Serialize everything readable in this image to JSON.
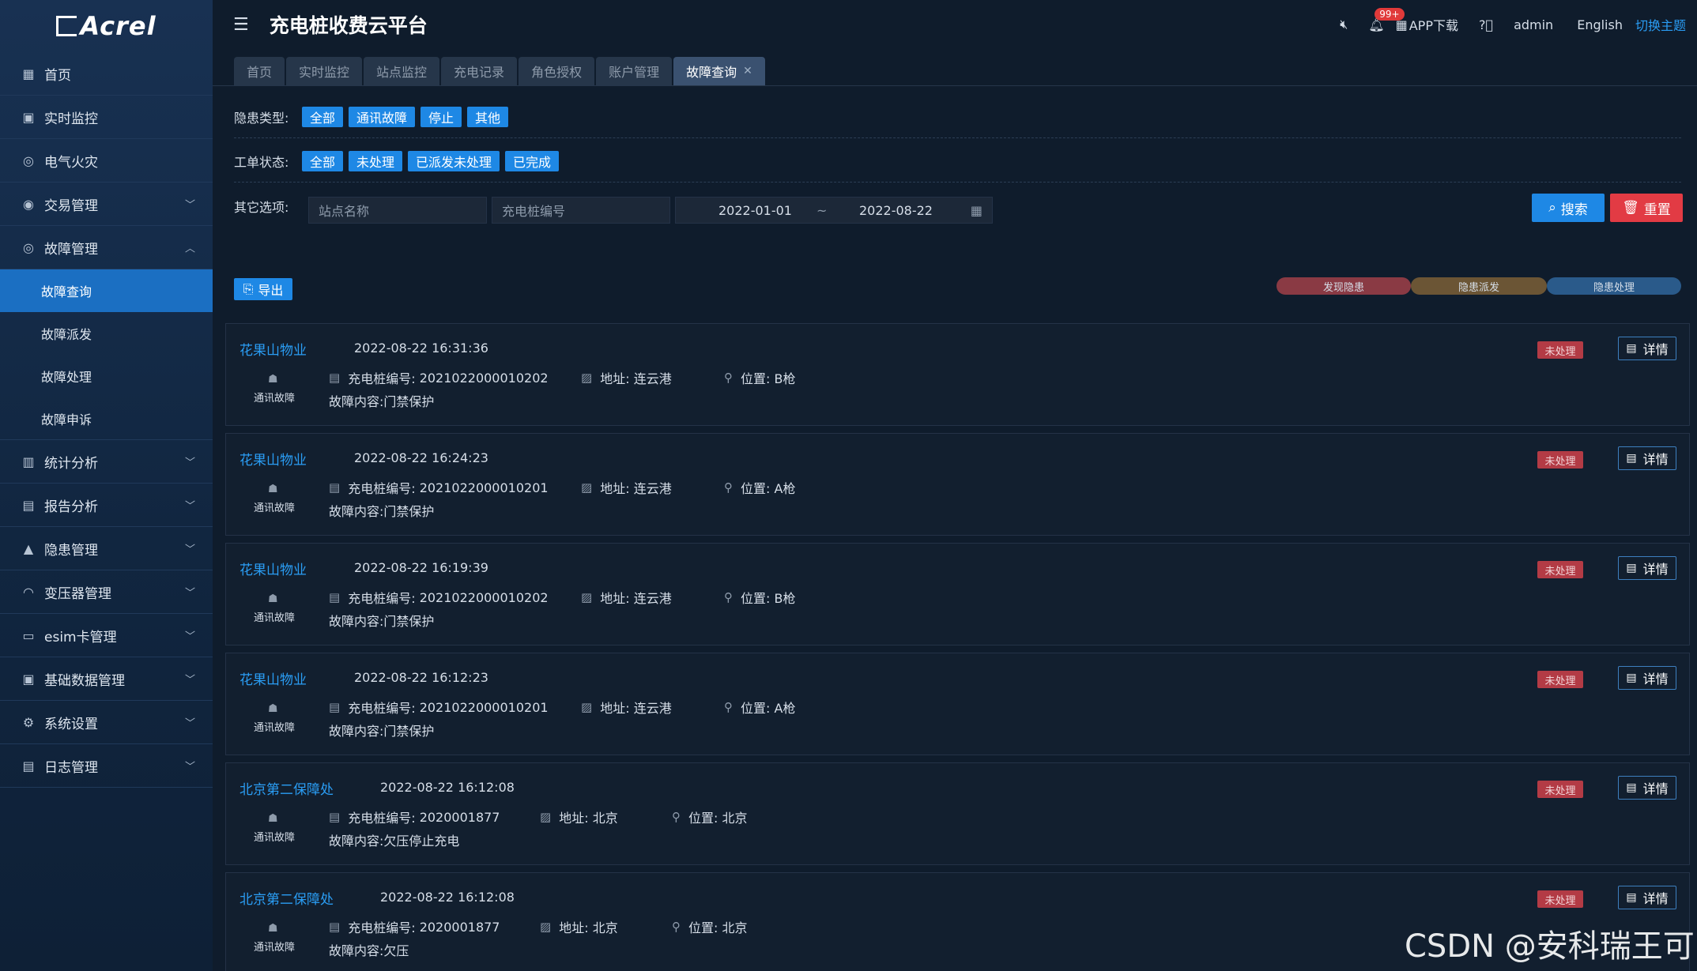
{
  "brand": {
    "logo_text": "Acrel"
  },
  "header": {
    "title": "充电桩收费云平台",
    "notification_count": "99+",
    "app_download": "APP下载",
    "user": "admin",
    "language": "English",
    "theme": "切换主题"
  },
  "sidebar": {
    "items": [
      {
        "label": "首页",
        "icon": "home-icon"
      },
      {
        "label": "实时监控",
        "icon": "monitor-icon"
      },
      {
        "label": "电气火灾",
        "icon": "fire-icon"
      },
      {
        "label": "交易管理",
        "icon": "transaction-icon"
      },
      {
        "label": "故障管理",
        "icon": "fault-icon"
      },
      {
        "label": "统计分析",
        "icon": "bar-chart-icon"
      },
      {
        "label": "报告分析",
        "icon": "report-icon"
      },
      {
        "label": "隐患管理",
        "icon": "hazard-icon"
      },
      {
        "label": "变压器管理",
        "icon": "transformer-icon"
      },
      {
        "label": "esim卡管理",
        "icon": "sim-icon"
      },
      {
        "label": "基础数据管理",
        "icon": "database-icon"
      },
      {
        "label": "系统设置",
        "icon": "settings-icon"
      },
      {
        "label": "日志管理",
        "icon": "log-icon"
      }
    ],
    "fault_sub": [
      "故障查询",
      "故障派发",
      "故障处理",
      "故障申诉"
    ]
  },
  "tabs": [
    "首页",
    "实时监控",
    "站点监控",
    "充电记录",
    "角色授权",
    "账户管理",
    "故障查询"
  ],
  "filters": {
    "hazard_type_label": "隐患类型:",
    "hazard_types": [
      "全部",
      "通讯故障",
      "停止",
      "其他"
    ],
    "order_status_label": "工单状态:",
    "order_statuses": [
      "全部",
      "未处理",
      "已派发未处理",
      "已完成"
    ],
    "other_label": "其它选项:",
    "site_placeholder": "站点名称",
    "pile_placeholder": "充电桩编号",
    "date_start": "2022-01-01",
    "date_sep": "~",
    "date_end": "2022-08-22",
    "search": "搜索",
    "reset": "重置"
  },
  "export_label": "导出",
  "legend": [
    {
      "label": "发现隐患",
      "color": "#8a3a44"
    },
    {
      "label": "隐患派发",
      "color": "#6b5535"
    },
    {
      "label": "隐患处理",
      "color": "#2a5a8a"
    }
  ],
  "labels": {
    "pile_no": "充电桩编号:",
    "address": "地址:",
    "location": "位置:",
    "detail": "详情"
  },
  "records": [
    {
      "site": "花果山物业",
      "time": "2022-08-22 16:31:36",
      "type": "通讯故障",
      "pile": "2021022000010202",
      "address": "连云港",
      "location": "B枪",
      "content": "故障内容:门禁保护",
      "status": "未处理"
    },
    {
      "site": "花果山物业",
      "time": "2022-08-22 16:24:23",
      "type": "通讯故障",
      "pile": "2021022000010201",
      "address": "连云港",
      "location": "A枪",
      "content": "故障内容:门禁保护",
      "status": "未处理"
    },
    {
      "site": "花果山物业",
      "time": "2022-08-22 16:19:39",
      "type": "通讯故障",
      "pile": "2021022000010202",
      "address": "连云港",
      "location": "B枪",
      "content": "故障内容:门禁保护",
      "status": "未处理"
    },
    {
      "site": "花果山物业",
      "time": "2022-08-22 16:12:23",
      "type": "通讯故障",
      "pile": "2021022000010201",
      "address": "连云港",
      "location": "A枪",
      "content": "故障内容:门禁保护",
      "status": "未处理"
    },
    {
      "site": "北京第二保障处",
      "time": "2022-08-22 16:12:08",
      "type": "通讯故障",
      "pile": "2020001877",
      "address": "北京",
      "location": "北京",
      "content": "故障内容:欠压停止充电",
      "status": "未处理"
    },
    {
      "site": "北京第二保障处",
      "time": "2022-08-22 16:12:08",
      "type": "通讯故障",
      "pile": "2020001877",
      "address": "北京",
      "location": "北京",
      "content": "故障内容:欠压",
      "status": "未处理"
    }
  ],
  "watermark": "CSDN @安科瑞王可"
}
